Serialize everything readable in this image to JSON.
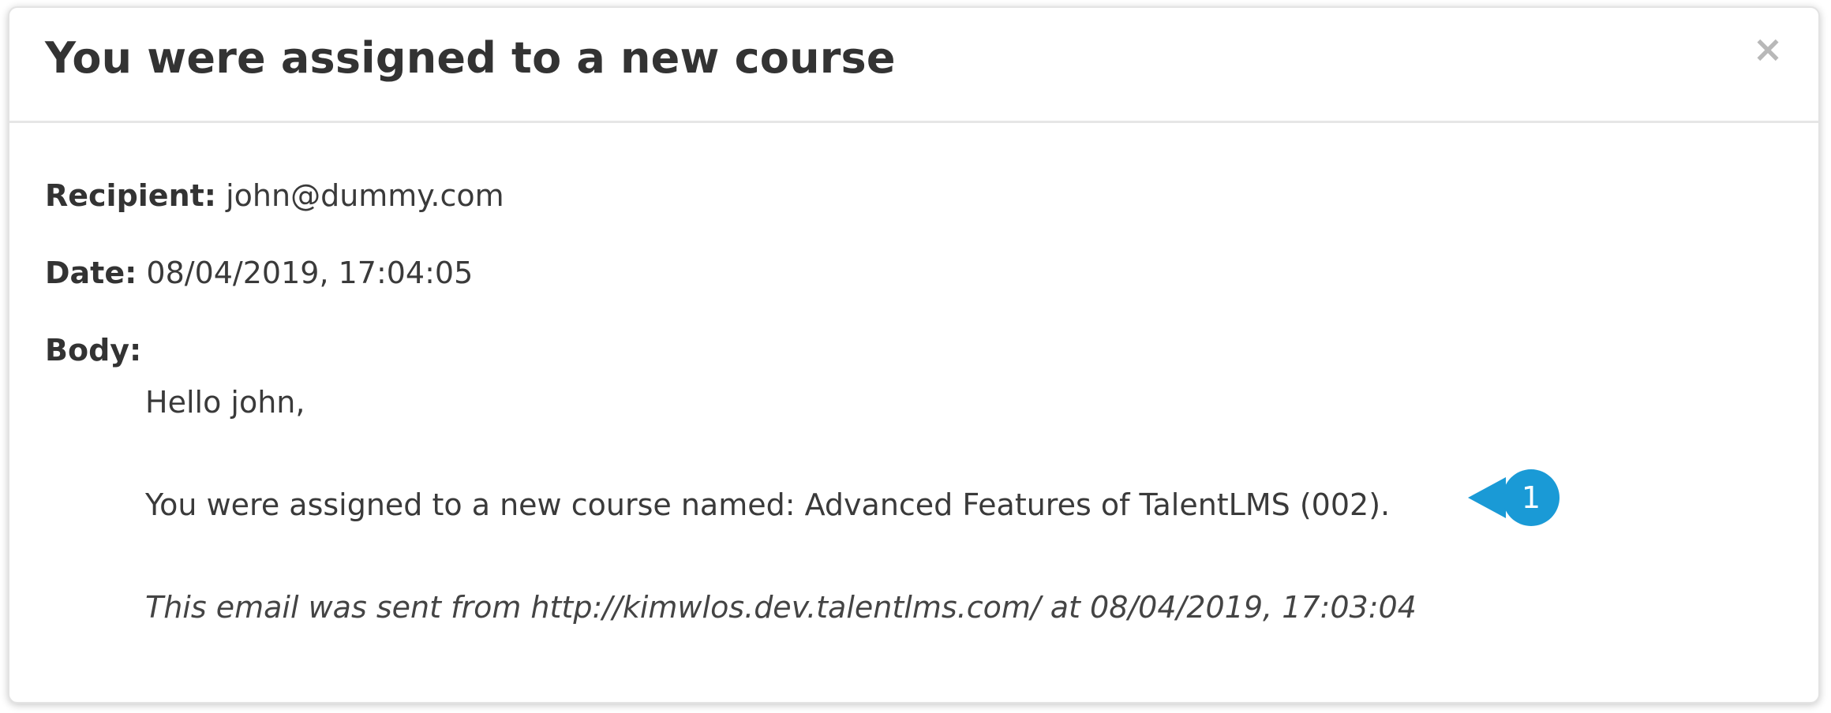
{
  "dialog": {
    "title": "You were assigned to a new course",
    "close_icon": "close-icon",
    "close_label": "×"
  },
  "email": {
    "recipient_label": "Recipient:",
    "recipient_value": "john@dummy.com",
    "date_label": "Date:",
    "date_value": "08/04/2019, 17:04:05",
    "body_label": "Body:",
    "body": {
      "greeting": "Hello john,",
      "message": "You were assigned to a new course named: Advanced Features of TalentLMS (002).",
      "footer": "This email was sent from http://kimwlos.dev.talentlms.com/ at 08/04/2019, 17:03:04"
    }
  },
  "callout": {
    "number": "1",
    "color": "#1a9ad6"
  },
  "colors": {
    "title_text": "#333333",
    "body_text": "#3a3a3a",
    "close_icon": "#b8b8b8",
    "divider": "#e6e6e6"
  }
}
